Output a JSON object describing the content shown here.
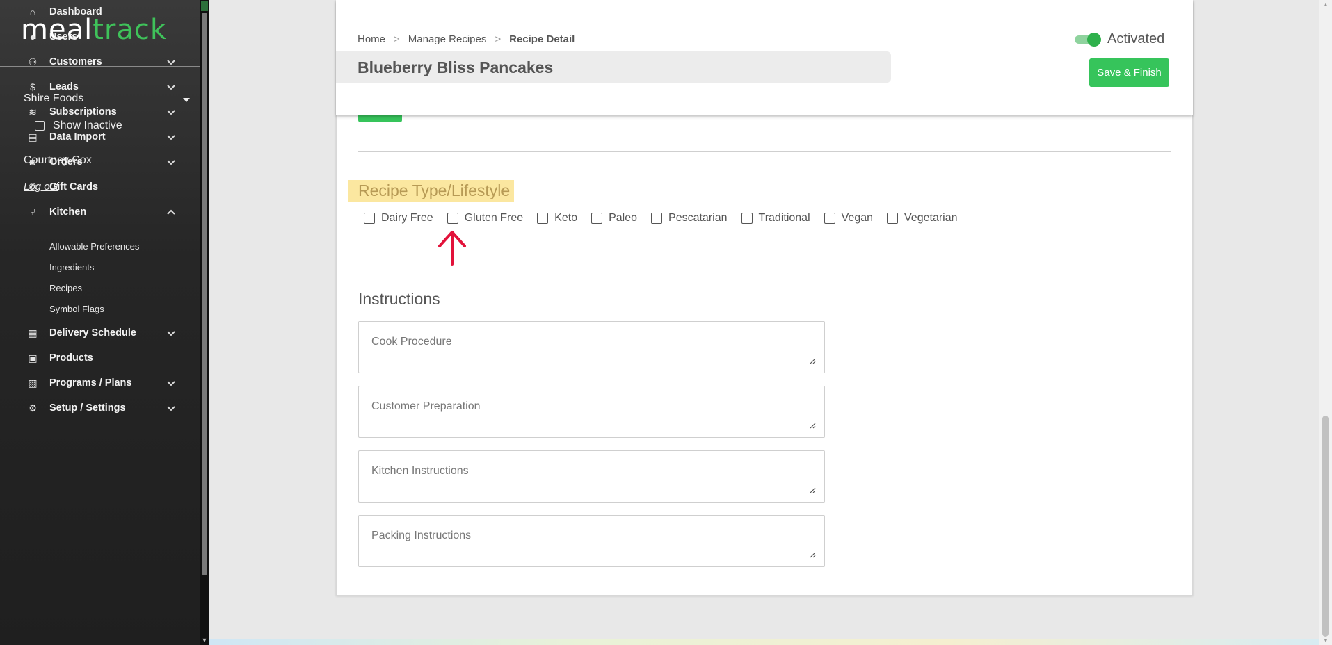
{
  "brand": {
    "part1": "meal",
    "part2": "track",
    "accent": "#36c45b"
  },
  "sidebar": {
    "org": "Shire Foods",
    "show_inactive": "Show Inactive",
    "user": "Courtney Cox",
    "logout": "Log out",
    "nav": [
      {
        "label": "Dashboard",
        "icon": "home-icon",
        "chev": false
      },
      {
        "label": "Users",
        "icon": "user-icon",
        "chev": false
      },
      {
        "label": "Customers",
        "icon": "users-icon",
        "chev": "down"
      },
      {
        "label": "Leads",
        "icon": "dollar-icon",
        "chev": "down"
      },
      {
        "label": "Subscriptions",
        "icon": "layers-icon",
        "chev": "down"
      },
      {
        "label": "Data Import",
        "icon": "file-icon",
        "chev": "down"
      },
      {
        "label": "Orders",
        "icon": "bag-icon",
        "chev": "down"
      },
      {
        "label": "Gift Cards",
        "icon": "phone-icon",
        "chev": false
      },
      {
        "label": "Kitchen",
        "icon": "utensils-icon",
        "chev": "up"
      },
      {
        "label": "Delivery Schedule",
        "icon": "calendar-icon",
        "chev": "down"
      },
      {
        "label": "Products",
        "icon": "box-icon",
        "chev": false
      },
      {
        "label": "Programs / Plans",
        "icon": "clipboard-icon",
        "chev": "down"
      },
      {
        "label": "Setup / Settings",
        "icon": "gear-icon",
        "chev": "down"
      }
    ],
    "kitchen_sub": [
      "Allowable Preferences",
      "Ingredients",
      "Recipes",
      "Symbol Flags"
    ]
  },
  "header": {
    "breadcrumb": [
      "Home",
      "Manage Recipes",
      "Recipe Detail"
    ],
    "title": "Blueberry Bliss Pancakes",
    "status": "Activated",
    "save": "Save & Finish"
  },
  "lifestyle": {
    "title": "Recipe Type/Lifestyle",
    "options": [
      "Dairy Free",
      "Gluten Free",
      "Keto",
      "Paleo",
      "Pescatarian",
      "Traditional",
      "Vegan",
      "Vegetarian"
    ]
  },
  "instructions": {
    "title": "Instructions",
    "fields": [
      "Cook Procedure",
      "Customer Preparation",
      "Kitchen Instructions",
      "Packing Instructions"
    ]
  }
}
